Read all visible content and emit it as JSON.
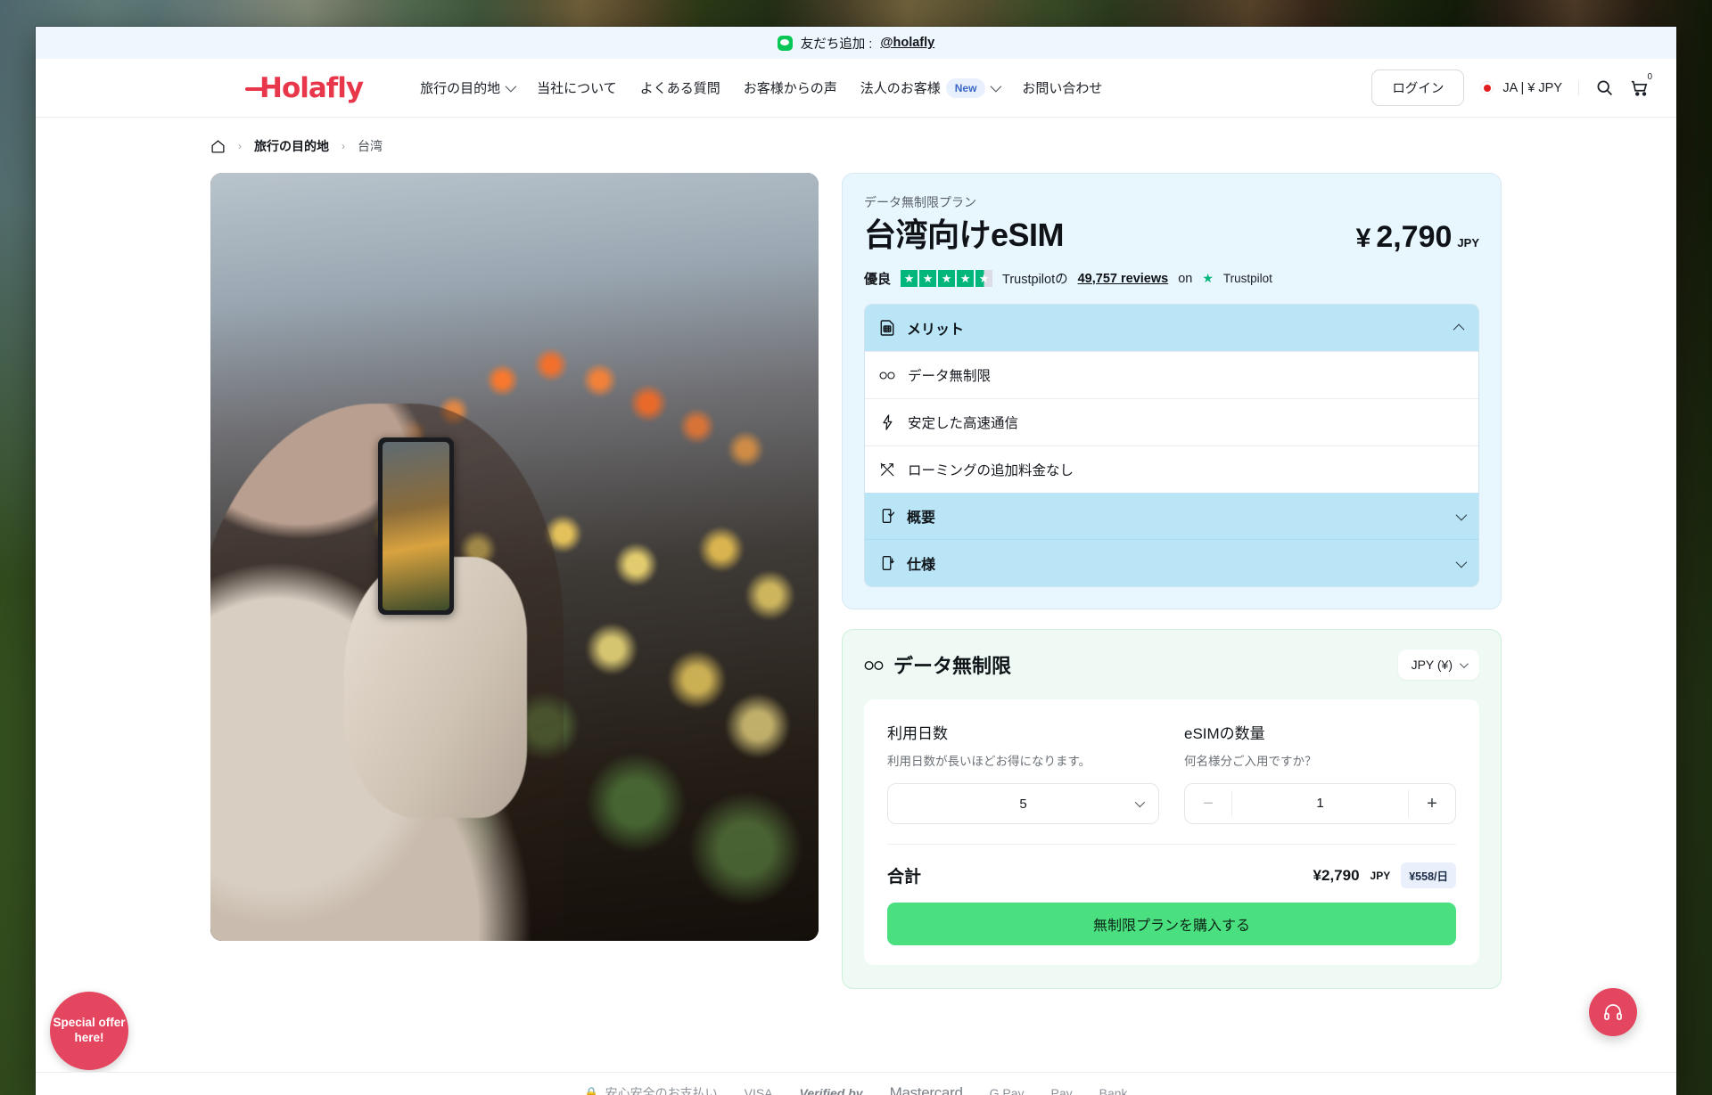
{
  "promo": {
    "icon": "line-chat-icon",
    "text": "友だち追加 : ",
    "handle": "@holafly"
  },
  "header": {
    "logo": "Holafly",
    "nav": [
      {
        "label": "旅行の目的地",
        "caret": true
      },
      {
        "label": "当社について",
        "caret": false
      },
      {
        "label": "よくある質問",
        "caret": false
      },
      {
        "label": "お客様からの声",
        "caret": false
      },
      {
        "label": "法人のお客様",
        "caret": true,
        "badge": "New"
      },
      {
        "label": "お問い合わせ",
        "caret": false
      }
    ],
    "login": "ログイン",
    "locale": "JA | ¥ JPY",
    "cart_count": "0"
  },
  "breadcrumb": {
    "home_icon": "home-icon",
    "items": [
      "旅行の目的地",
      "台湾"
    ]
  },
  "product": {
    "kicker": "データ無制限プラン",
    "title": "台湾向けeSIM",
    "price_symbol": "¥",
    "price_value": "2,790",
    "price_currency": "JPY",
    "rating": {
      "word": "優良",
      "stars": 4.5,
      "prefix": "Trustpilotの",
      "reviews": "49,757 reviews",
      "on": "on",
      "brand": "Trustpilot"
    },
    "accordion": [
      {
        "label": "メリット",
        "icon": "sim-card-icon",
        "open": true,
        "rows": [
          {
            "icon": "infinity-icon",
            "label": "データ無制限"
          },
          {
            "icon": "bolt-icon",
            "label": "安定した高速通信"
          },
          {
            "icon": "no-roaming-icon",
            "label": "ローミングの追加料金なし"
          }
        ]
      },
      {
        "label": "概要",
        "icon": "device-check-icon",
        "open": false,
        "rows": []
      },
      {
        "label": "仕様",
        "icon": "device-download-icon",
        "open": false,
        "rows": []
      }
    ]
  },
  "purchase": {
    "icon": "infinity-icon",
    "title": "データ無制限",
    "currency_select": "JPY (¥)",
    "days": {
      "label": "利用日数",
      "hint": "利用日数が長いほどお得になります。",
      "value": "5"
    },
    "quantity": {
      "label": "eSIMの数量",
      "hint": "何名様分ご入用ですか？",
      "value": "1",
      "minus": "−",
      "plus": "+"
    },
    "total_label": "合計",
    "total_value": "¥2,790",
    "total_currency": "JPY",
    "per_day": "¥558/日",
    "cta": "無制限プランを購入する"
  },
  "floating": {
    "offer": "Special offer here!",
    "offer_lines": [
      "Special",
      "offer",
      "here!"
    ],
    "chat_icon": "headset-support-icon"
  },
  "payments": {
    "title": "安心安全のお支払い",
    "items": [
      "VISA",
      "Verified by",
      "Mastercard",
      "G Pay",
      "Pay",
      "Bank"
    ]
  },
  "colors": {
    "brand_red": "#e8374a",
    "plan_card_bg": "#e8f6fd",
    "accordion_head": "#b9e5f7",
    "buy_card_bg": "#eefaf3",
    "cta_green": "#4ae07f",
    "trustpilot_green": "#00b67a",
    "line_green": "#06c755",
    "badge_blue": "#3b68c4",
    "offer_red": "#e4455f"
  }
}
